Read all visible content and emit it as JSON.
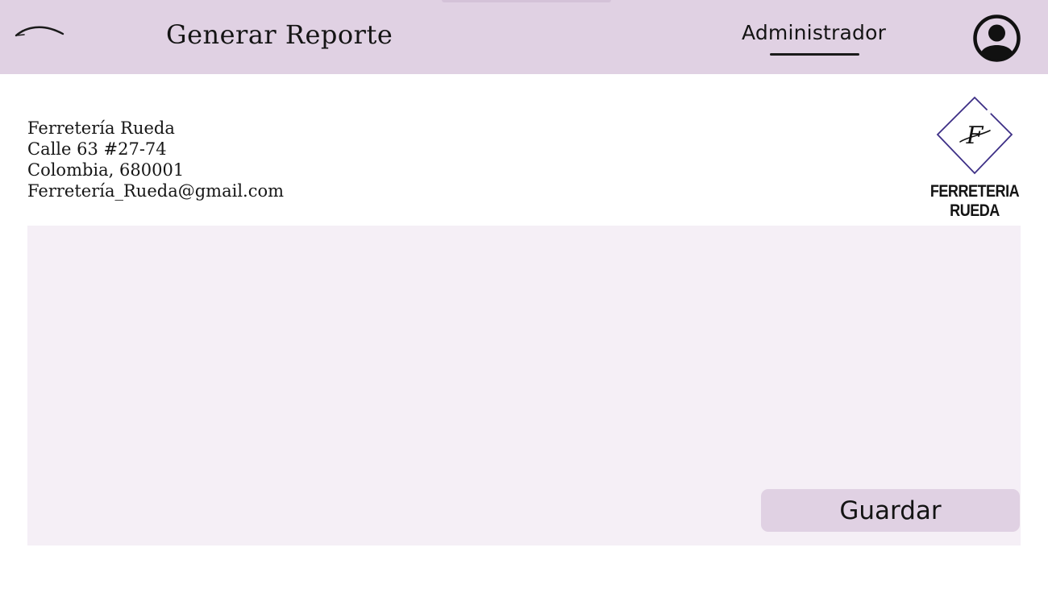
{
  "header": {
    "title": "Generar Reporte",
    "role_label": "Administrador",
    "back_icon": "back-arrow-icon",
    "avatar_icon": "user-avatar-icon"
  },
  "company": {
    "name": "Ferretería Rueda",
    "address": "Calle 63 #27-74",
    "city": "Colombia, 680001",
    "email": "Ferretería_Rueda@gmail.com"
  },
  "brand": {
    "monogram": "F",
    "name": "FERRETERIA RUEDA",
    "accent_color": "#3d2f86"
  },
  "actions": {
    "save_label": "Guardar"
  },
  "colors": {
    "header_bg": "#e0d1e3",
    "report_bg": "#f5eff6",
    "button_bg": "#e0d1e3"
  }
}
